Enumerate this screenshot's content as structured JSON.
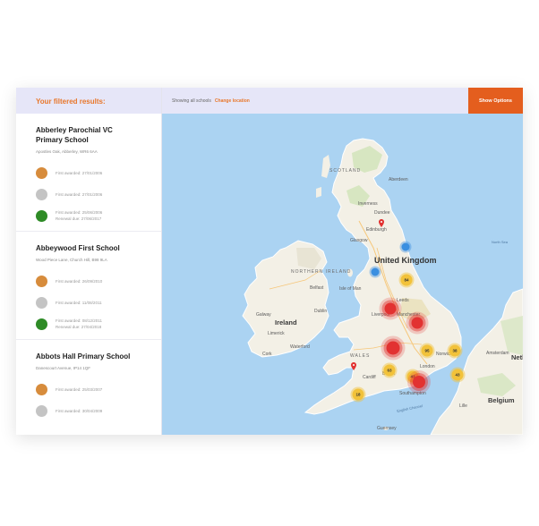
{
  "sidebar": {
    "title": "Your filtered results:",
    "schools": [
      {
        "name": "Abberley Parochial VC Primary School",
        "address": "Apostles Oak, Abberley, WR6 6AA",
        "awards": [
          {
            "color": "#d78c3c",
            "lines": [
              "First awarded: 27/01/2006"
            ]
          },
          {
            "color": "#c4c4c4",
            "lines": [
              "First awarded: 27/01/2006"
            ]
          },
          {
            "color": "#2e8b26",
            "lines": [
              "First awarded: 25/06/2006",
              "Renewal due: 27/06/2017"
            ]
          }
        ]
      },
      {
        "name": "Abbeywood First School",
        "address": "Wood Piece Lane, Church Hill, B98 9LA",
        "awards": [
          {
            "color": "#d78c3c",
            "lines": [
              "First awarded: 26/09/2010"
            ]
          },
          {
            "color": "#c4c4c4",
            "lines": [
              "First awarded: 11/08/2011"
            ]
          },
          {
            "color": "#2e8b26",
            "lines": [
              "First awarded: 08/12/2011",
              "Renewal due: 27/04/2018"
            ]
          }
        ]
      },
      {
        "name": "Abbots Hall Primary School",
        "address": "Danescourt Avenue, IP14 1QF",
        "awards": [
          {
            "color": "#d78c3c",
            "lines": [
              "First awarded: 25/03/2007"
            ]
          },
          {
            "color": "#c4c4c4",
            "lines": [
              "First awarded: 30/04/2009"
            ]
          }
        ]
      }
    ]
  },
  "topbar": {
    "showing_text": "Showing all schools",
    "change_location": "Change location",
    "show_options": "Show Options"
  },
  "map": {
    "labels": {
      "scotland": "SCOTLAND",
      "united_kingdom": "United Kingdom",
      "northern_ireland": "NORTHERN IRELAND",
      "ireland": "Ireland",
      "isle_of_man": "Isle of Man",
      "wales": "WALES",
      "belgium": "Belgium",
      "netherlands": "Nethe",
      "edinburgh": "Edinburgh",
      "glasgow": "Glasgow",
      "dundee": "Dundee",
      "aberdeen": "Aberdeen",
      "inverness": "Inverness",
      "belfast": "Belfast",
      "dublin": "Dublin",
      "galway": "Galway",
      "cork": "Cork",
      "limerick": "Limerick",
      "waterford": "Waterford",
      "leeds": "Leeds",
      "manchester": "Manchester",
      "liverpool": "Liverpool",
      "london": "London",
      "cardiff": "Cardiff",
      "bristol": "Bristol",
      "southampton": "Southampton",
      "guernsey": "Guernsey",
      "english_channel": "English Channel",
      "north_sea": "North Sea",
      "norwich": "Norwich",
      "amsterdam": "Amsterdam",
      "lille": "Lille"
    },
    "clusters": [
      {
        "label": "84",
        "type": "yellow"
      },
      {
        "label": "",
        "type": "blue"
      },
      {
        "label": "",
        "type": "blue"
      },
      {
        "label": "",
        "type": "red"
      },
      {
        "label": "",
        "type": "red"
      },
      {
        "label": "",
        "type": "red"
      },
      {
        "label": "",
        "type": "red"
      },
      {
        "label": "95",
        "type": "yellow"
      },
      {
        "label": "38",
        "type": "yellow"
      },
      {
        "label": "43",
        "type": "yellow"
      },
      {
        "label": "43",
        "type": "yellow"
      },
      {
        "label": "63",
        "type": "yellow"
      },
      {
        "label": "18",
        "type": "yellow"
      }
    ]
  }
}
